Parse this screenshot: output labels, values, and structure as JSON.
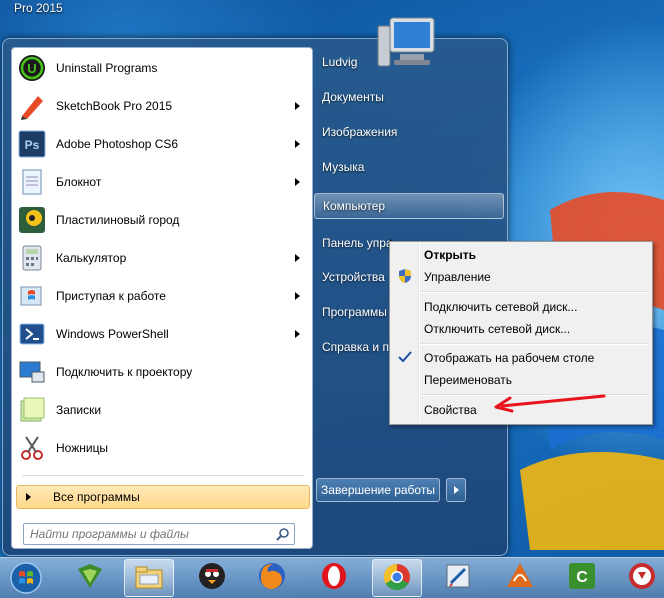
{
  "desktop": {
    "top_label": "Pro 2015"
  },
  "start_menu": {
    "programs": [
      {
        "label": "Uninstall Programs",
        "icon": "uninstall-icon",
        "submenu": false
      },
      {
        "label": "SketchBook Pro 2015",
        "icon": "sketchbook-icon",
        "submenu": true
      },
      {
        "label": "Adobe Photoshop CS6",
        "icon": "photoshop-icon",
        "submenu": true
      },
      {
        "label": "Блокнот",
        "icon": "notepad-icon",
        "submenu": true
      },
      {
        "label": "Пластилиновый город",
        "icon": "plasticine-city-icon",
        "submenu": false
      },
      {
        "label": "Калькулятор",
        "icon": "calculator-icon",
        "submenu": true
      },
      {
        "label": "Приступая к работе",
        "icon": "getting-started-icon",
        "submenu": true
      },
      {
        "label": "Windows PowerShell",
        "icon": "powershell-icon",
        "submenu": true
      },
      {
        "label": "Подключить к проектору",
        "icon": "projector-icon",
        "submenu": false
      },
      {
        "label": "Записки",
        "icon": "sticky-notes-icon",
        "submenu": false
      },
      {
        "label": "Ножницы",
        "icon": "snipping-tool-icon",
        "submenu": false
      }
    ],
    "all_programs": "Все программы",
    "search_placeholder": "Найти программы и файлы",
    "right_items": [
      {
        "label": "Ludvig"
      },
      {
        "label": "Документы"
      },
      {
        "label": "Изображения"
      },
      {
        "label": "Музыка"
      },
      {
        "label": "Компьютер"
      },
      {
        "label": "Панель упра"
      },
      {
        "label": "Устройства"
      },
      {
        "label": "Программы"
      },
      {
        "label": "Справка и п"
      }
    ],
    "shutdown_label": "Завершение работы"
  },
  "context_menu": {
    "items": [
      {
        "label": "Открыть",
        "bold": true
      },
      {
        "label": "Управление",
        "icon": "shield-icon"
      },
      {
        "label": "Подключить сетевой диск..."
      },
      {
        "label": "Отключить сетевой диск..."
      },
      {
        "label": "Отображать на рабочем столе",
        "checked": true
      },
      {
        "label": "Переименовать"
      },
      {
        "label": "Свойства"
      }
    ]
  },
  "taskbar": {
    "apps": [
      "start-orb",
      "antivirus-icon",
      "explorer-icon",
      "angry-birds-icon",
      "firefox-icon",
      "opera-icon",
      "chrome-icon",
      "paint-icon",
      "flash-icon",
      "camtasia-icon",
      "recorder-icon"
    ]
  },
  "colors": {
    "annotation_arrow": "#e8141b",
    "all_programs_bg": "#ffd88a"
  }
}
